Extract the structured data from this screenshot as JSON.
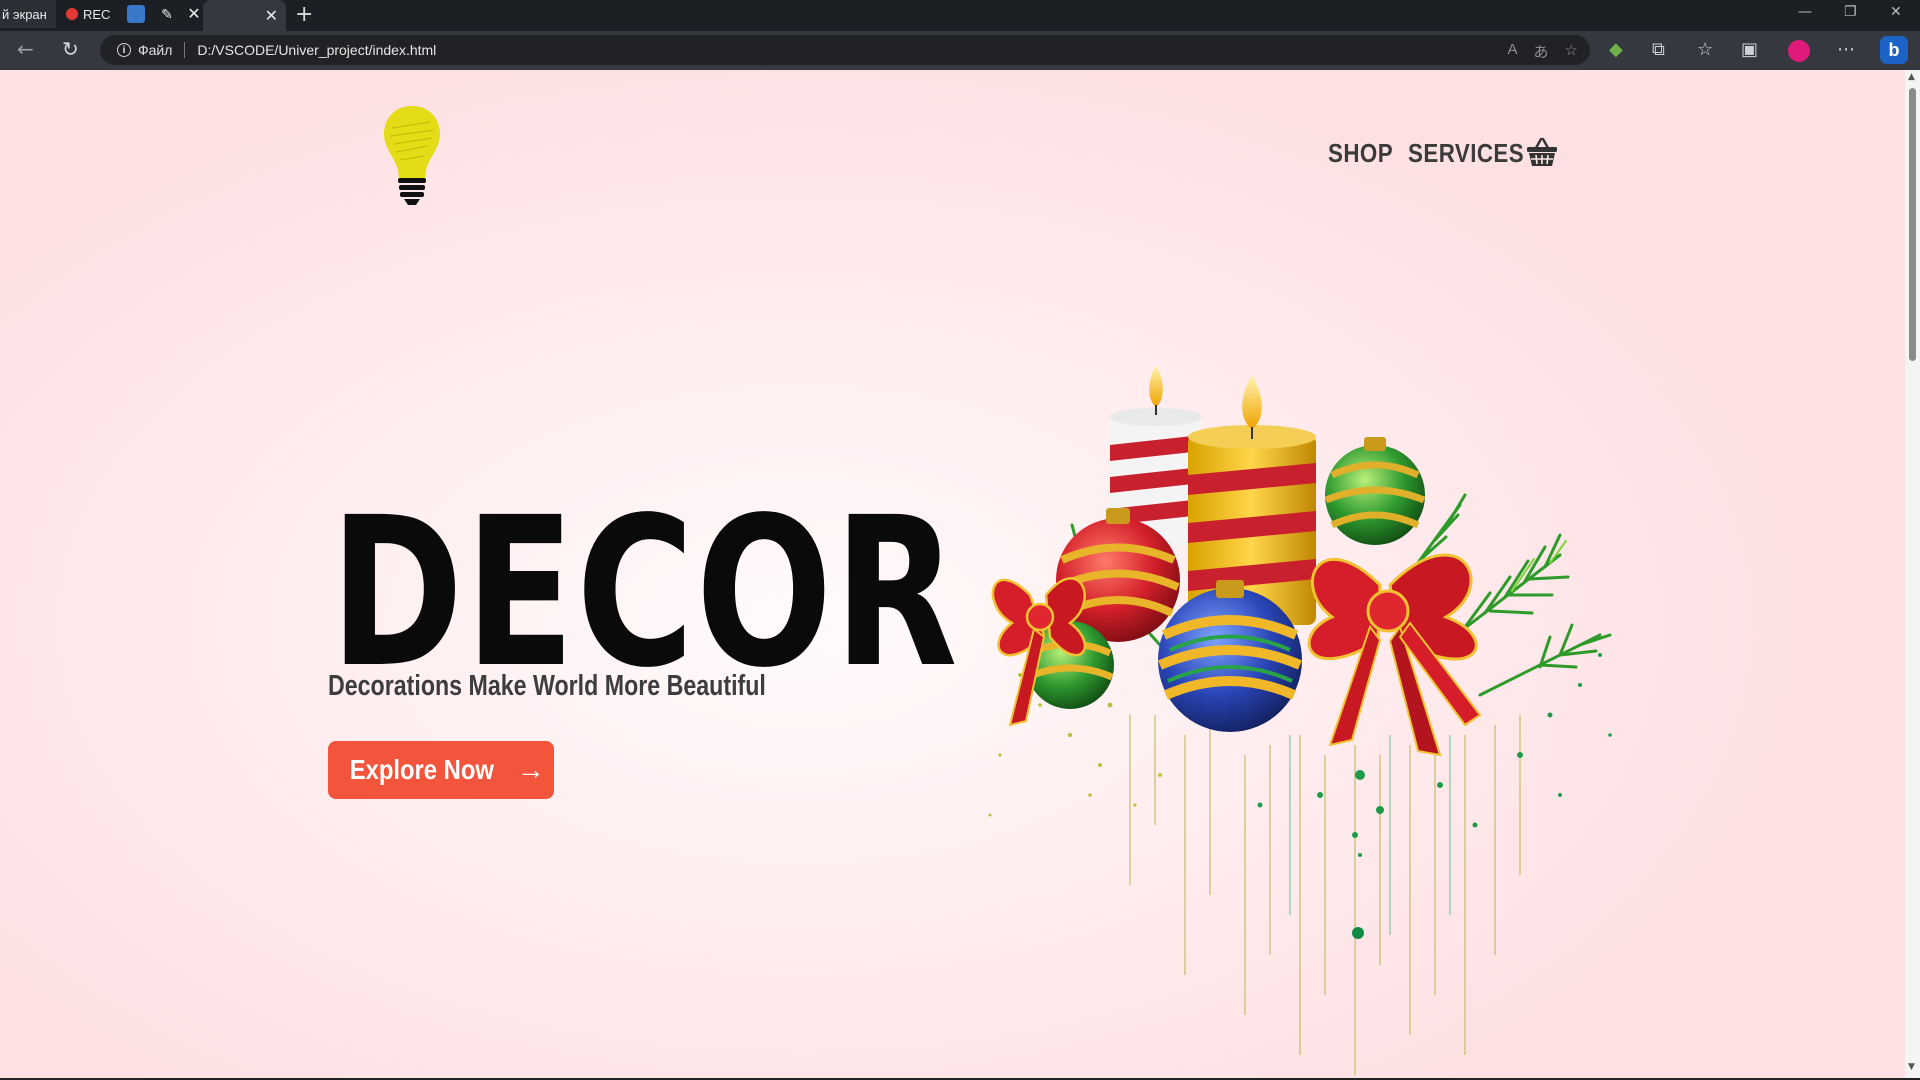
{
  "browser": {
    "tabs": [
      {
        "label": "й экран"
      },
      {
        "label": "REC"
      },
      {
        "label": ""
      },
      {
        "label": ""
      },
      {
        "label": ""
      }
    ],
    "address": {
      "scheme_label": "Файл",
      "url": "D:/VSCODE/Univer_project/index.html"
    }
  },
  "site": {
    "nav": {
      "shop": "SHOP",
      "services": "SERVICES"
    },
    "hero": {
      "title": "DECOR",
      "subtitle": "Decorations Make World More Beautiful",
      "cta_label": "Explore Now",
      "cta_arrow": "→"
    },
    "colors": {
      "cta_bg": "#f3553c",
      "title": "#0a0a0a",
      "nav_text": "#3b3b3b",
      "page_bg": "#ffeef0"
    }
  }
}
